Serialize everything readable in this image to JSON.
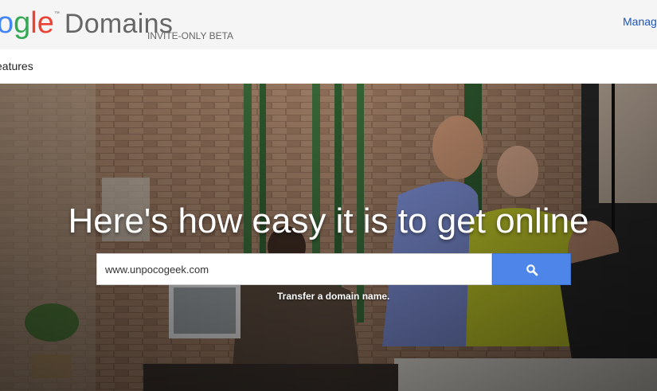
{
  "header": {
    "logo_g1": "o",
    "logo_g2": "g",
    "logo_g3": "le",
    "logo_tm": "™",
    "logo_product": "Domains",
    "beta_label": "INVITE-ONLY BETA",
    "manage_link": "Manag"
  },
  "nav": {
    "features": "eatures"
  },
  "hero": {
    "headline": "Here's how easy it is to get online",
    "search_value": "www.unpocogeek.com",
    "search_icon": "search-icon",
    "transfer_link": "Transfer a domain name."
  },
  "colors": {
    "brand_blue": "#4285f4",
    "brand_green": "#34a853",
    "brand_red": "#ea4335",
    "search_button": "#4d85e8",
    "link": "#1a55c0"
  }
}
